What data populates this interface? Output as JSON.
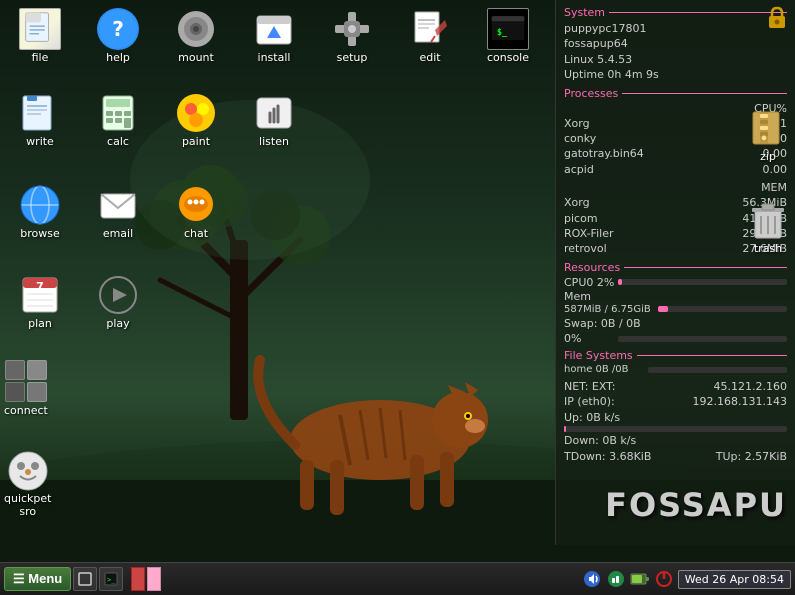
{
  "desktop": {
    "background": "night scene with tree and feline animal"
  },
  "icons": {
    "top_row": [
      {
        "id": "file",
        "label": "file",
        "type": "file"
      },
      {
        "id": "help",
        "label": "help",
        "type": "help"
      },
      {
        "id": "mount",
        "label": "mount",
        "type": "mount"
      },
      {
        "id": "install",
        "label": "install",
        "type": "install"
      },
      {
        "id": "setup",
        "label": "setup",
        "type": "setup"
      },
      {
        "id": "edit",
        "label": "edit",
        "type": "edit"
      },
      {
        "id": "console",
        "label": "console",
        "type": "console"
      }
    ],
    "row2": [
      {
        "id": "write",
        "label": "write",
        "type": "write"
      },
      {
        "id": "calc",
        "label": "calc",
        "type": "calc"
      },
      {
        "id": "paint",
        "label": "paint",
        "type": "paint"
      },
      {
        "id": "listen",
        "label": "listen",
        "type": "listen"
      }
    ],
    "row3": [
      {
        "id": "browse",
        "label": "browse",
        "type": "browse"
      },
      {
        "id": "email",
        "label": "email",
        "type": "email"
      },
      {
        "id": "chat",
        "label": "chat",
        "type": "chat"
      }
    ],
    "row4": [
      {
        "id": "plan",
        "label": "plan",
        "type": "plan"
      },
      {
        "id": "play",
        "label": "play",
        "type": "play"
      }
    ],
    "right_side": [
      {
        "id": "lock",
        "label": "lock",
        "type": "lock"
      },
      {
        "id": "zip",
        "label": "zip",
        "type": "zip"
      },
      {
        "id": "trash",
        "label": "trash",
        "type": "trash"
      }
    ],
    "bottom_left": [
      {
        "id": "connect",
        "label": "connect",
        "type": "connect"
      },
      {
        "id": "quickpet",
        "label": "quickpet\nsro",
        "type": "quickpet"
      }
    ]
  },
  "sysmon": {
    "system_title": "System",
    "hostname": "puppypc17801",
    "user": "fossapup64",
    "kernel": "Linux 5.4.53",
    "uptime": "Uptime 0h 4m 9s",
    "processes_title": "Processes",
    "processes_header_cpu": "CPU%",
    "processes": [
      {
        "name": "Xorg",
        "cpu": "1.01",
        "mem": "56.3MiB"
      },
      {
        "name": "conky",
        "cpu": "0.00",
        "mem": "41.8MiB"
      },
      {
        "name": "gatotray.bin64",
        "cpu": "0.00",
        "mem": "29.4MiB"
      },
      {
        "name": "acpid",
        "cpu": "0.00",
        "mem": "27.6MiB"
      }
    ],
    "mem_header": "MEM",
    "processes2": [
      {
        "name": "Xorg",
        "cpu": "",
        "mem": "56.3MiB"
      },
      {
        "name": "picom",
        "cpu": "",
        "mem": "41.8MiB"
      },
      {
        "name": "ROX-Filer",
        "cpu": "",
        "mem": "29.4MiB"
      },
      {
        "name": "retrovol",
        "cpu": "",
        "mem": "27.6MiB"
      }
    ],
    "resources_title": "Resources",
    "cpu0_label": "CPU0 2%",
    "cpu0_pct": 2,
    "mem_label": "Mem",
    "mem_values": "587MiB / 6.75GiB",
    "mem_pct": 8,
    "swap_label": "Swap: 0B  / 0B",
    "swap_pct": 0,
    "swap_pct_label": "0%",
    "fs_title": "File Systems",
    "home_label": "home 0B  /0B",
    "home_pct": 0,
    "net_ext_label": "NET: EXT:",
    "net_ext_val": "45.121.2.160",
    "ip_label": "IP (eth0):",
    "ip_val": "192.168.131.143",
    "up_label": "Up: 0B  k/s",
    "down_label": "Down: 0B  k/s",
    "tdown_label": "TDown: 3.68KiB",
    "tup_label": "TUp: 2.57KiB"
  },
  "brand": "FOSSAPU",
  "taskbar": {
    "menu_label": "☰ Menu",
    "datetime": "Wed 26 Apr 08:54",
    "items": []
  }
}
